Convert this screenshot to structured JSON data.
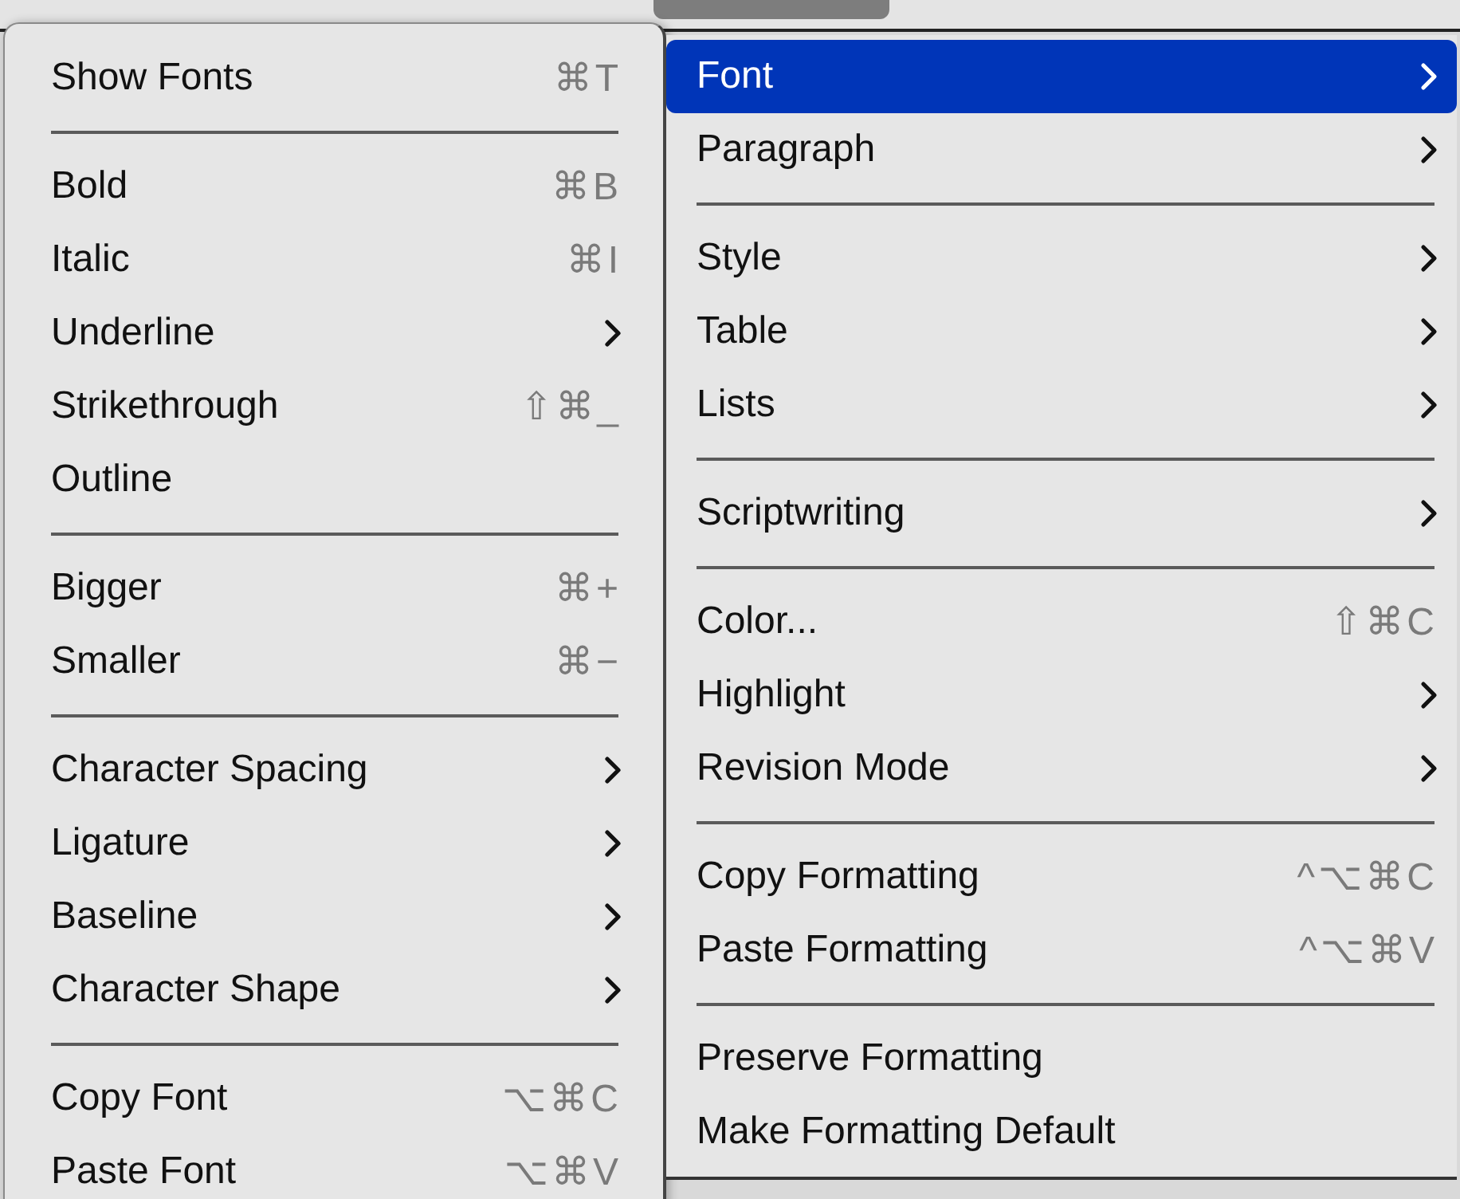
{
  "format_menu": {
    "items": [
      {
        "kind": "item",
        "label": "Show Fonts",
        "shortcut": "⌘T",
        "submenu": false
      },
      {
        "kind": "separator"
      },
      {
        "kind": "item",
        "label": "Bold",
        "shortcut": "⌘B",
        "submenu": false
      },
      {
        "kind": "item",
        "label": "Italic",
        "shortcut": "⌘I",
        "submenu": false
      },
      {
        "kind": "item",
        "label": "Underline",
        "submenu": true
      },
      {
        "kind": "item",
        "label": "Strikethrough",
        "shortcut": "⇧⌘_",
        "submenu": false
      },
      {
        "kind": "item",
        "label": "Outline",
        "submenu": false
      },
      {
        "kind": "separator"
      },
      {
        "kind": "item",
        "label": "Bigger",
        "shortcut": "⌘+",
        "submenu": false
      },
      {
        "kind": "item",
        "label": "Smaller",
        "shortcut": "⌘−",
        "submenu": false
      },
      {
        "kind": "separator"
      },
      {
        "kind": "item",
        "label": "Character Spacing",
        "submenu": true
      },
      {
        "kind": "item",
        "label": "Ligature",
        "submenu": true
      },
      {
        "kind": "item",
        "label": "Baseline",
        "submenu": true
      },
      {
        "kind": "item",
        "label": "Character Shape",
        "submenu": true
      },
      {
        "kind": "separator"
      },
      {
        "kind": "item",
        "label": "Copy Font",
        "shortcut": "⌥⌘C",
        "submenu": false
      },
      {
        "kind": "item",
        "label": "Paste Font",
        "shortcut": "⌥⌘V",
        "submenu": false
      }
    ]
  },
  "submenu": {
    "items": [
      {
        "kind": "item",
        "label": "Font",
        "submenu": true,
        "selected": true
      },
      {
        "kind": "item",
        "label": "Paragraph",
        "submenu": true,
        "selected": false
      },
      {
        "kind": "separator"
      },
      {
        "kind": "item",
        "label": "Style",
        "submenu": true,
        "selected": false
      },
      {
        "kind": "item",
        "label": "Table",
        "submenu": true,
        "selected": false
      },
      {
        "kind": "item",
        "label": "Lists",
        "submenu": true,
        "selected": false
      },
      {
        "kind": "separator"
      },
      {
        "kind": "item",
        "label": "Scriptwriting",
        "submenu": true,
        "selected": false
      },
      {
        "kind": "separator"
      },
      {
        "kind": "item",
        "label": "Color...",
        "shortcut": "⇧⌘C",
        "submenu": false,
        "selected": false
      },
      {
        "kind": "item",
        "label": "Highlight",
        "submenu": true,
        "selected": false
      },
      {
        "kind": "item",
        "label": "Revision Mode",
        "submenu": true,
        "selected": false
      },
      {
        "kind": "separator"
      },
      {
        "kind": "item",
        "label": "Copy Formatting",
        "shortcut": "^⌥⌘C",
        "submenu": false,
        "selected": false
      },
      {
        "kind": "item",
        "label": "Paste Formatting",
        "shortcut": "^⌥⌘V",
        "submenu": false,
        "selected": false
      },
      {
        "kind": "separator"
      },
      {
        "kind": "item",
        "label": "Preserve Formatting",
        "submenu": false,
        "selected": false
      },
      {
        "kind": "item",
        "label": "Make Formatting Default",
        "submenu": false,
        "selected": false
      }
    ]
  }
}
